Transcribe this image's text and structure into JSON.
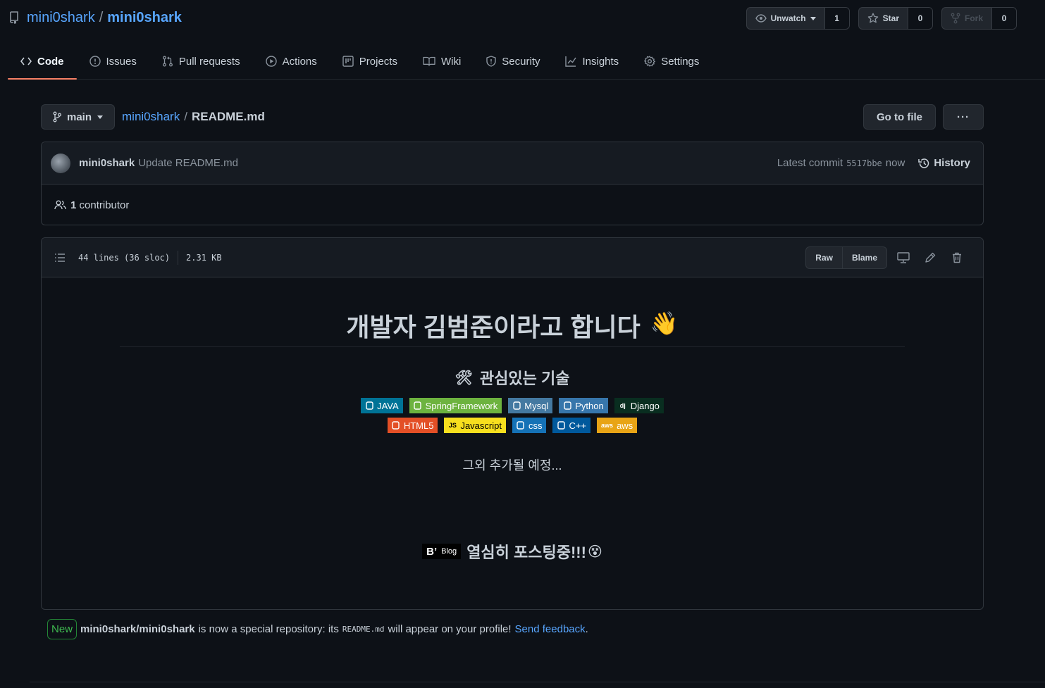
{
  "repo": {
    "owner": "mini0shark",
    "name": "mini0shark"
  },
  "actions": {
    "watch": {
      "label": "Unwatch",
      "count": "1"
    },
    "star": {
      "label": "Star",
      "count": "0"
    },
    "fork": {
      "label": "Fork",
      "count": "0"
    }
  },
  "tabs": [
    {
      "label": "Code",
      "icon": "code-icon",
      "active": true
    },
    {
      "label": "Issues",
      "icon": "issue-icon"
    },
    {
      "label": "Pull requests",
      "icon": "pull-request-icon"
    },
    {
      "label": "Actions",
      "icon": "play-icon"
    },
    {
      "label": "Projects",
      "icon": "project-icon"
    },
    {
      "label": "Wiki",
      "icon": "book-icon"
    },
    {
      "label": "Security",
      "icon": "shield-icon"
    },
    {
      "label": "Insights",
      "icon": "graph-icon"
    },
    {
      "label": "Settings",
      "icon": "gear-icon"
    }
  ],
  "filenav": {
    "branch": "main",
    "crumb_repo": "mini0shark",
    "crumb_sep": "/",
    "crumb_file": "README.md",
    "go_to_file": "Go to file",
    "more": "···"
  },
  "commit": {
    "author": "mini0shark",
    "message": "Update README.md",
    "latest_label": "Latest commit",
    "sha": "5517bbe",
    "time": "now",
    "history": "History"
  },
  "contributors": {
    "count": "1",
    "label": "contributor"
  },
  "file": {
    "lines": "44 lines (36 sloc)",
    "size": "2.31 KB",
    "raw": "Raw",
    "blame": "Blame"
  },
  "readme": {
    "title": "개발자 김범준이라고 합니다",
    "title_emoji": "👋",
    "section_emoji": "🛠",
    "section_title": "관심있는 기술",
    "badges_row1": [
      {
        "label": "JAVA",
        "color": "#007396",
        "logo": "java-icon"
      },
      {
        "label": "SpringFramework",
        "color": "#6db33f",
        "logo": "spring-icon"
      },
      {
        "label": "Mysql",
        "color": "#4479a1",
        "logo": "mysql-icon"
      },
      {
        "label": "Python",
        "color": "#3776ab",
        "logo": "python-icon"
      },
      {
        "label": "Django",
        "color": "#092e20",
        "logo": "django-icon",
        "logo_text": "dj"
      }
    ],
    "badges_row2": [
      {
        "label": "HTML5",
        "color": "#e34f26",
        "logo": "html5-icon"
      },
      {
        "label": "Javascript",
        "color": "#f7df1e",
        "text_color": "#000000",
        "logo": "javascript-icon",
        "logo_text": "JS"
      },
      {
        "label": "css",
        "color": "#1572b6",
        "logo": "css3-icon"
      },
      {
        "label": "C++",
        "color": "#00599c",
        "logo": "cplusplus-icon"
      },
      {
        "label": "aws",
        "color": "#e8a416",
        "logo": "aws-icon",
        "logo_text": "aws"
      }
    ],
    "extra": "그외 추가될 예정...",
    "blog_badge": "B’",
    "blog_badge_small": "Blog",
    "blog_text": "열심히 포스팅중!!!",
    "blog_emoji": "😵"
  },
  "notice": {
    "new_label": "New",
    "repo_full": "mini0shark/mini0shark",
    "text1": "is now a special repository: its",
    "code": "README.md",
    "text2": "will appear on your profile!",
    "feedback": "Send feedback",
    "period": "."
  },
  "colors": {
    "accent": "#58a6ff",
    "tab_underline": "#f78166",
    "bg": "#0d1117"
  }
}
